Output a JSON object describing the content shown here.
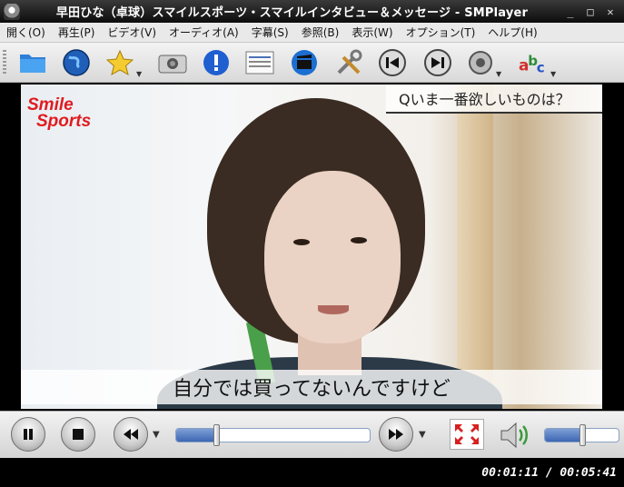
{
  "window": {
    "title": "早田ひな（卓球）スマイルスポーツ・スマイルインタビュー＆メッセージ - SMPlayer"
  },
  "menu": [
    "開く(O)",
    "再生(P)",
    "ビデオ(V)",
    "オーディオ(A)",
    "字幕(S)",
    "参照(B)",
    "表示(W)",
    "オプション(T)",
    "ヘルプ(H)"
  ],
  "toolbar": {
    "icons": [
      "open-folder-icon",
      "open-url-globe-icon",
      "favorites-star-icon",
      "screenshot-camera-icon",
      "info-icon",
      "playlist-icon",
      "video-clapper-icon",
      "preferences-tools-icon",
      "previous-track-icon",
      "next-track-icon",
      "audio-track-icon",
      "subtitle-track-icon"
    ]
  },
  "video": {
    "logo_line1": "Smile",
    "logo_line2": "Sports",
    "question": "Qいま一番欲しいものは？",
    "subtitle": "自分では買ってないんですけど"
  },
  "controls": {
    "seek_progress": 0.207,
    "volume_level": 0.5
  },
  "status": {
    "time": "00:01:11 / 00:05:41"
  },
  "colors": {
    "logo_red": "#e01b20",
    "slider_blue": "#3c67b3"
  }
}
